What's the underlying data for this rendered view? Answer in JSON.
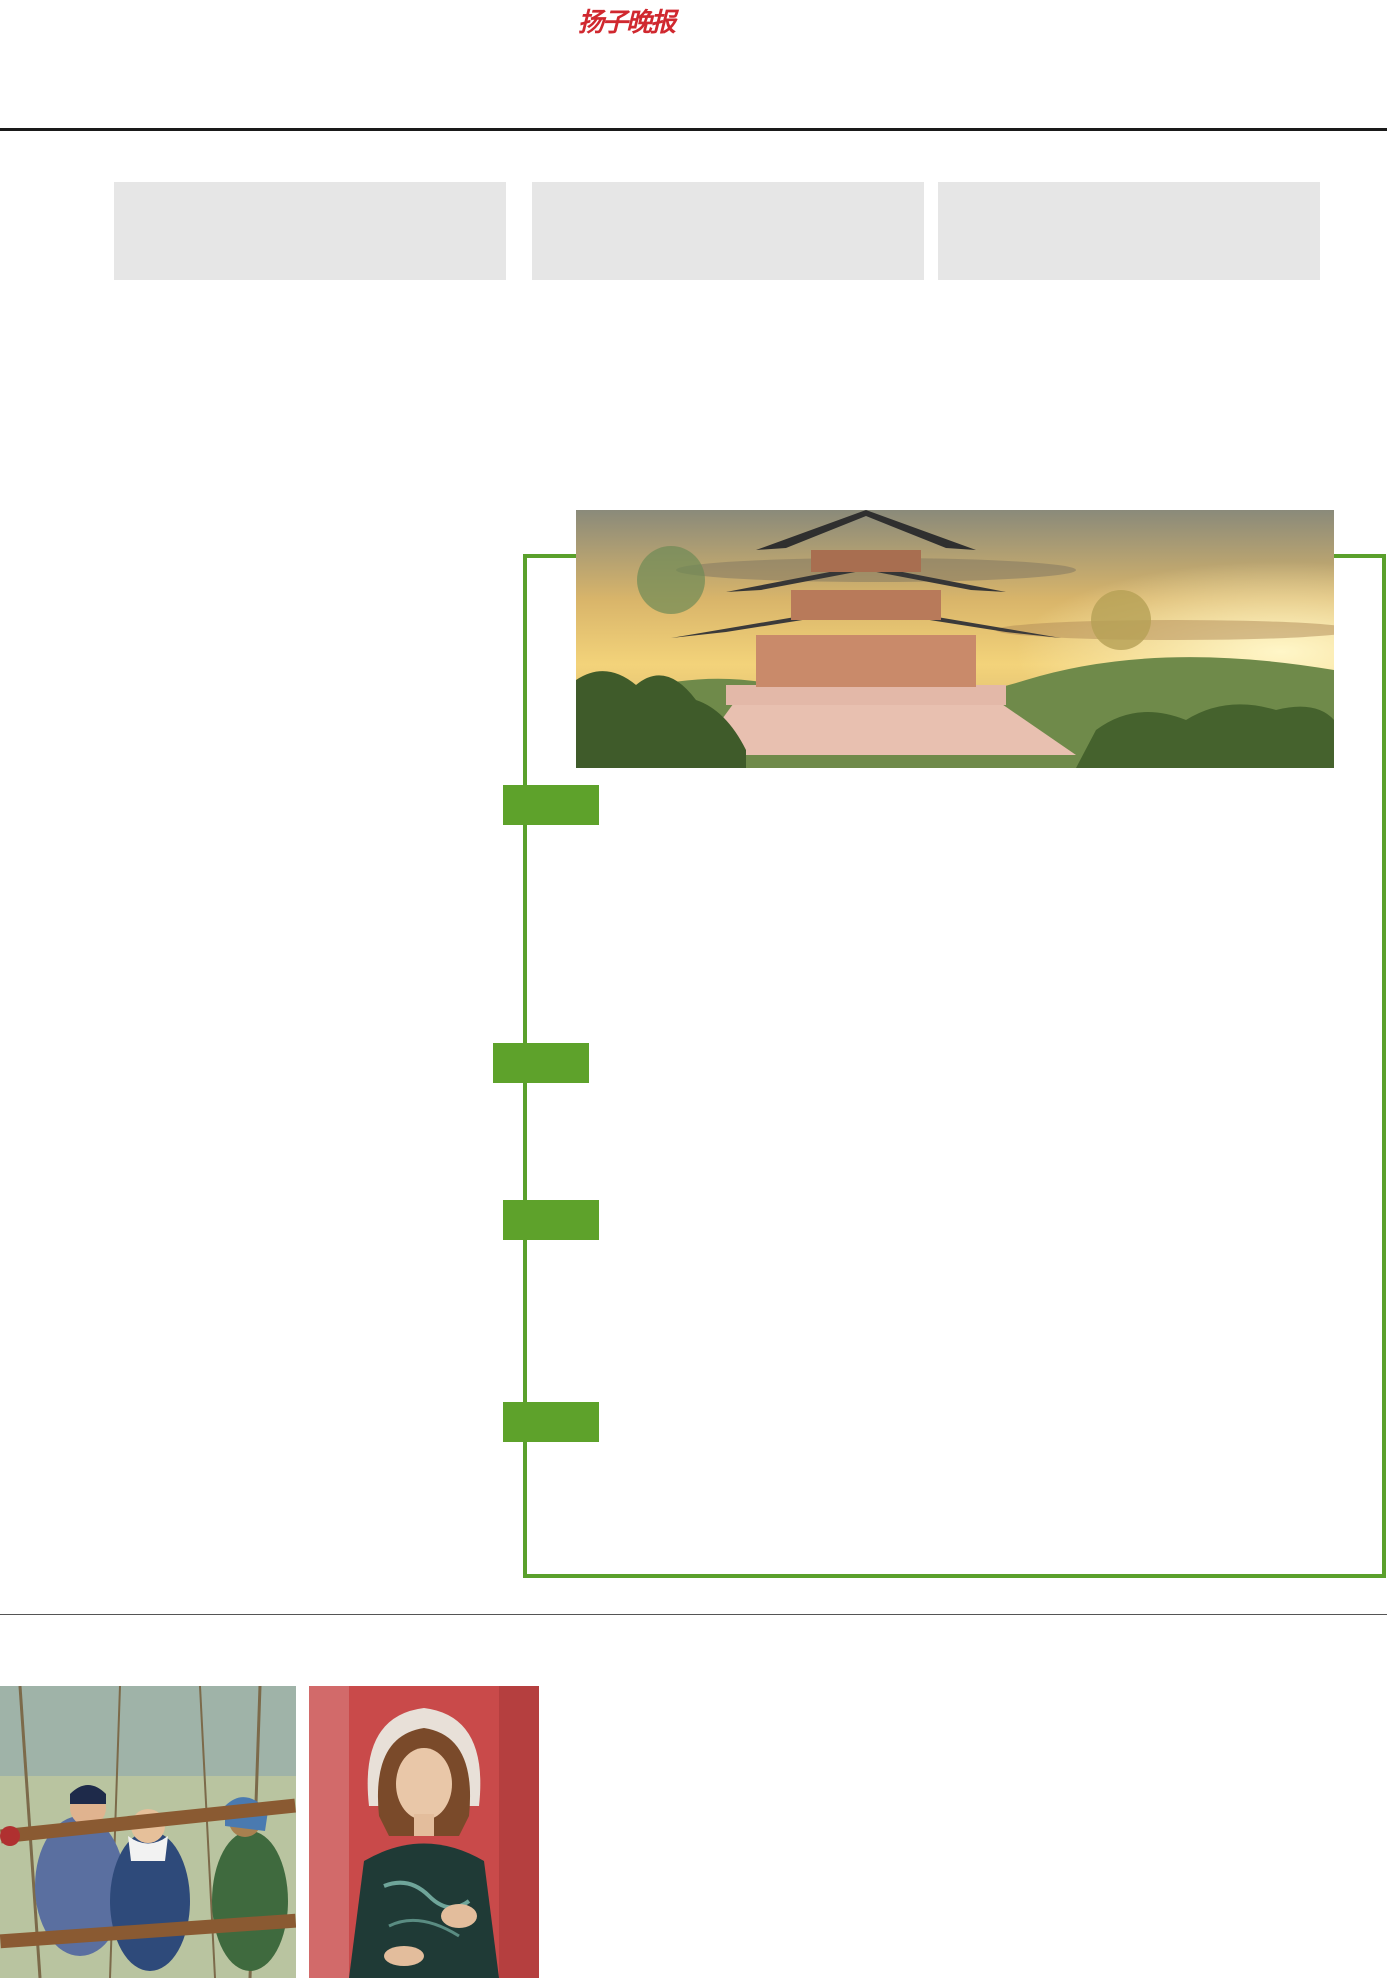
{
  "masthead": {
    "logo_text": "扬子晚报",
    "logo_color": "#d0282f"
  },
  "colors": {
    "accent_green": "#5ea22b",
    "frame_green": "#5aa02c",
    "promo_gray": "#e6e6e6",
    "rule": "#1a1a1a"
  },
  "images": {
    "temple": {
      "icon": "pagoda-temple-photo"
    },
    "painting_left": {
      "icon": "three-women-carrying-pole-painting"
    },
    "painting_right": {
      "icon": "woman-portrait-painting"
    }
  }
}
